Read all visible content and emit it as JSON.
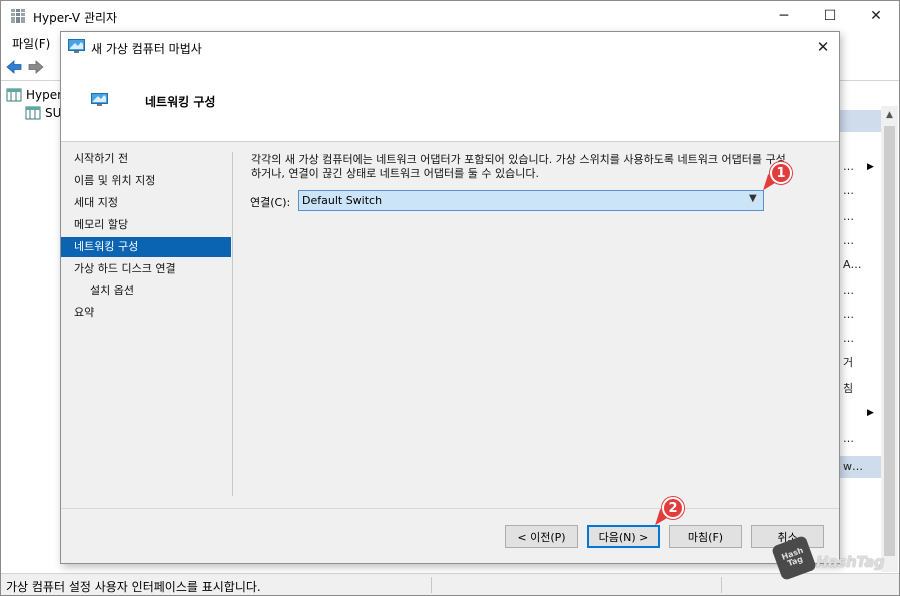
{
  "main_window": {
    "title": "Hyper-V 관리자",
    "menu_file": "파일(F)",
    "tree_root": "Hyper",
    "tree_child": "SU"
  },
  "actions_pane": {
    "items": [
      {
        "text": "…"
      },
      {
        "text": "…"
      },
      {
        "text": "…"
      },
      {
        "text": "…"
      },
      {
        "text": "…"
      },
      {
        "text": "A…"
      },
      {
        "text": "…"
      },
      {
        "text": "…"
      },
      {
        "text": "…"
      },
      {
        "text": "거"
      },
      {
        "text": "침"
      },
      {
        "text": "w…"
      }
    ]
  },
  "status_bar": {
    "text": "가상 컴퓨터 설정 사용자 인터페이스를 표시합니다."
  },
  "wizard": {
    "title": "새 가상 컴퓨터 마법사",
    "page_title": "네트워킹 구성",
    "nav_items": [
      {
        "label": "시작하기 전"
      },
      {
        "label": "이름 및 위치 지정"
      },
      {
        "label": "세대 지정"
      },
      {
        "label": "메모리 할당"
      },
      {
        "label": "네트워킹 구성"
      },
      {
        "label": "가상 하드 디스크 연결"
      },
      {
        "label": "설치 옵션"
      },
      {
        "label": "요약"
      }
    ],
    "description_line1": "각각의 새 가상 컴퓨터에는 네트워크 어댑터가 포함되어 있습니다. 가상 스위치를 사용하도록 네트워크 어댑터를 구성",
    "description_line2": "하거나, 연결이 끊긴 상태로 네트워크 어댑터를 둘 수 있습니다.",
    "connection_label": "연결(C):",
    "connection_value": "Default Switch",
    "buttons": {
      "prev": "< 이전(P)",
      "next": "다음(N) >",
      "finish": "마침(F)",
      "cancel": "취소"
    }
  },
  "annotations": {
    "badge1": "1",
    "badge2": "2"
  },
  "watermark": {
    "logo": "Hash Tag",
    "text": "HashTag"
  },
  "colors": {
    "selection": "#0a64b2",
    "dropdown_bg": "#cce4f7",
    "badge": "#e23c3c"
  }
}
